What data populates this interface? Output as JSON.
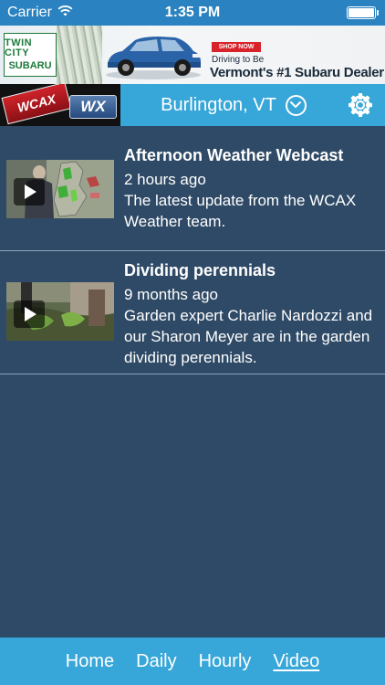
{
  "status_bar": {
    "carrier": "Carrier",
    "time": "1:35 PM",
    "battery_level": 1.0
  },
  "ad": {
    "logo_line1": "TWIN CITY",
    "logo_line2": "SUBARU",
    "shop_now": "SHOP NOW",
    "tagline": "Driving to Be",
    "headline": "Vermont's #1 Subaru Dealer"
  },
  "header": {
    "logo_wcax": "WCAX",
    "logo_wx": "WX",
    "location": "Burlington, VT",
    "icons": [
      "chevron-down-circle-icon",
      "gear-icon"
    ]
  },
  "videos": [
    {
      "title": "Afternoon Weather Webcast",
      "age": "2 hours ago",
      "description": "The latest update from the WCAX Weather team."
    },
    {
      "title": "Dividing perennials",
      "age": "9 months ago",
      "description": "Garden expert Charlie Nardozzi and our Sharon Meyer are in the garden dividing perennials."
    }
  ],
  "tabs": [
    "Home",
    "Daily",
    "Hourly",
    "Video"
  ],
  "active_tab": "Video",
  "colors": {
    "background": "#2f4a66",
    "accent": "#37a6d8",
    "status_bar": "#2a82c0"
  }
}
